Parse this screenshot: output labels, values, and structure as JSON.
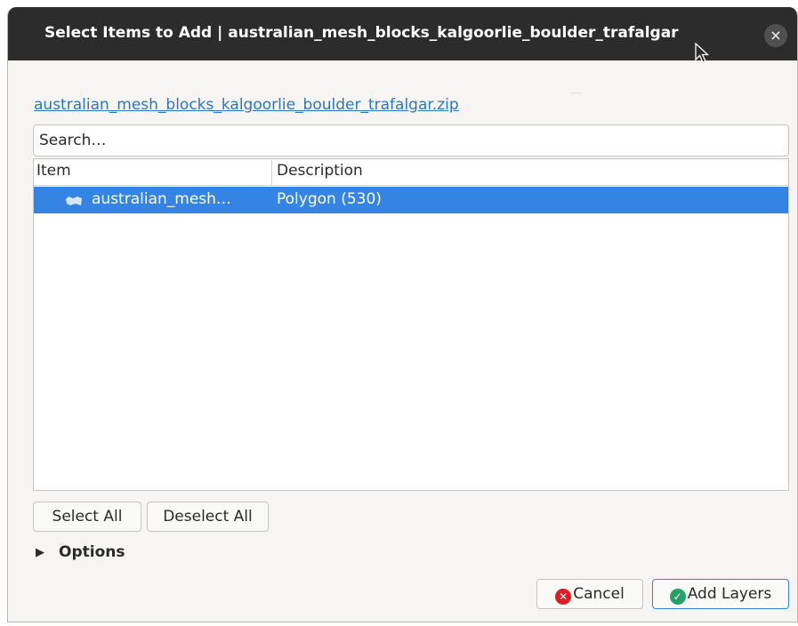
{
  "dialog": {
    "title": "Select Items to Add | australian_mesh_blocks_kalgoorlie_boulder_trafalgar",
    "close_icon": "close-icon"
  },
  "source_link": "australian_mesh_blocks_kalgoorlie_boulder_trafalgar.zip",
  "search": {
    "placeholder": "Search…",
    "value": ""
  },
  "table": {
    "columns": [
      "Item",
      "Description"
    ],
    "rows": [
      {
        "item": "australian_mesh…",
        "description": "Polygon (530)",
        "icon": "polygon-layer-icon",
        "selected": true
      }
    ]
  },
  "buttons": {
    "select_all": "Select All",
    "deselect_all": "Deselect All",
    "cancel": "Cancel",
    "add_layers": "Add Layers"
  },
  "options": {
    "label": "Options",
    "expanded": false
  },
  "colors": {
    "titlebar": "#2c2c2c",
    "selection": "#3584e4",
    "link": "#2a76c6",
    "cancel_icon": "#e01b24",
    "add_icon": "#26a269"
  }
}
